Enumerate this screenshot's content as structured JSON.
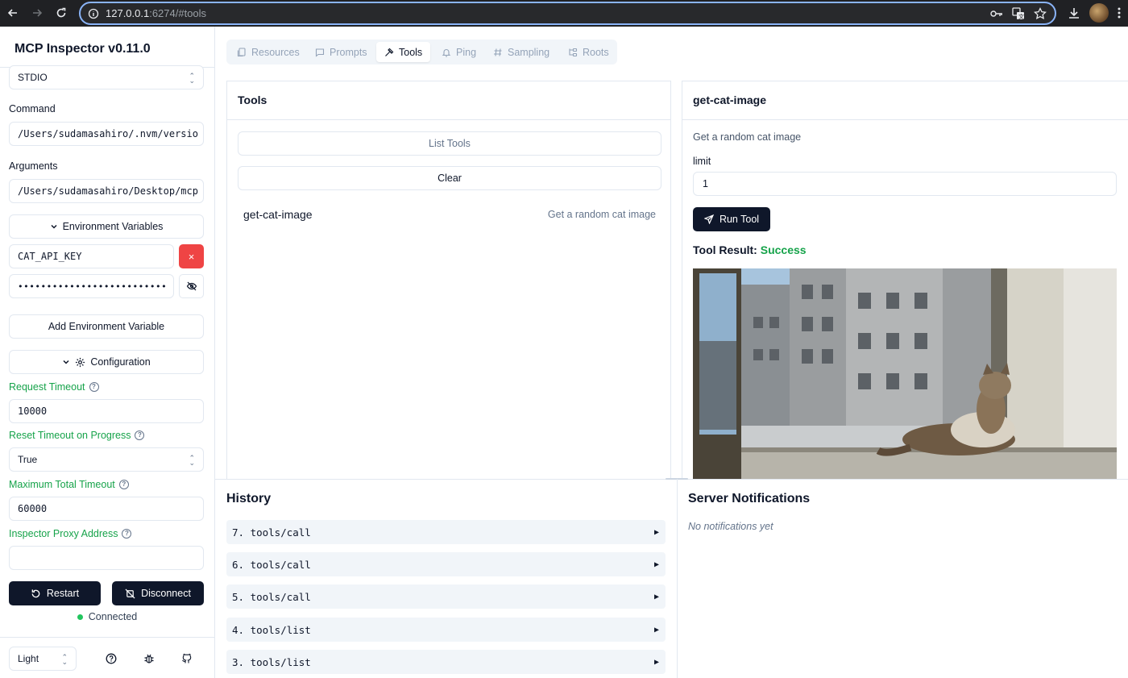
{
  "browser": {
    "url_host": "127.0.0.1",
    "url_rest": ":6274/#tools"
  },
  "sidebar": {
    "title": "MCP Inspector v0.11.0",
    "transport": "STDIO",
    "command_label": "Command",
    "command_value": "/Users/sudamasahiro/.nvm/versio",
    "arguments_label": "Arguments",
    "arguments_value": "/Users/sudamasahiro/Desktop/mcp",
    "env_toggle_label": "Environment Variables",
    "env_key": "CAT_API_KEY",
    "env_remove_label": "×",
    "env_value_masked": "••••••••••••••••••••••••••",
    "add_env_label": "Add Environment Variable",
    "config_toggle_label": "Configuration",
    "request_timeout_label": "Request Timeout",
    "request_timeout_value": "10000",
    "reset_timeout_label": "Reset Timeout on Progress",
    "reset_timeout_value": "True",
    "max_timeout_label": "Maximum Total Timeout",
    "max_timeout_value": "60000",
    "proxy_label": "Inspector Proxy Address",
    "proxy_value": "",
    "restart_label": "Restart",
    "disconnect_label": "Disconnect",
    "status_text": "Connected",
    "theme_value": "Light"
  },
  "tabs": [
    {
      "label": "Resources",
      "icon": "files-icon"
    },
    {
      "label": "Prompts",
      "icon": "message-square-icon"
    },
    {
      "label": "Tools",
      "icon": "hammer-icon"
    },
    {
      "label": "Ping",
      "icon": "bell-icon"
    },
    {
      "label": "Sampling",
      "icon": "hash-icon"
    },
    {
      "label": "Roots",
      "icon": "folder-tree-icon"
    }
  ],
  "tools_panel": {
    "title": "Tools",
    "list_label": "List Tools",
    "clear_label": "Clear",
    "tools": [
      {
        "name": "get-cat-image",
        "description": "Get a random cat image"
      }
    ]
  },
  "tool_detail": {
    "title": "get-cat-image",
    "description": "Get a random cat image",
    "param_label": "limit",
    "param_value": "1",
    "run_label": "Run Tool",
    "result_prefix": "Tool Result:",
    "result_status": "Success"
  },
  "history": {
    "title": "History",
    "items": [
      {
        "label": "7. tools/call"
      },
      {
        "label": "6. tools/call"
      },
      {
        "label": "5. tools/call"
      },
      {
        "label": "4. tools/list"
      },
      {
        "label": "3. tools/list"
      }
    ],
    "expand_glyph": "▶"
  },
  "notifications": {
    "title": "Server Notifications",
    "empty_text": "No notifications yet"
  },
  "colors": {
    "accent_dark": "#0f172a",
    "success_green": "#16a34a",
    "danger_red": "#ef4444",
    "url_border": "#8ab4f8"
  }
}
